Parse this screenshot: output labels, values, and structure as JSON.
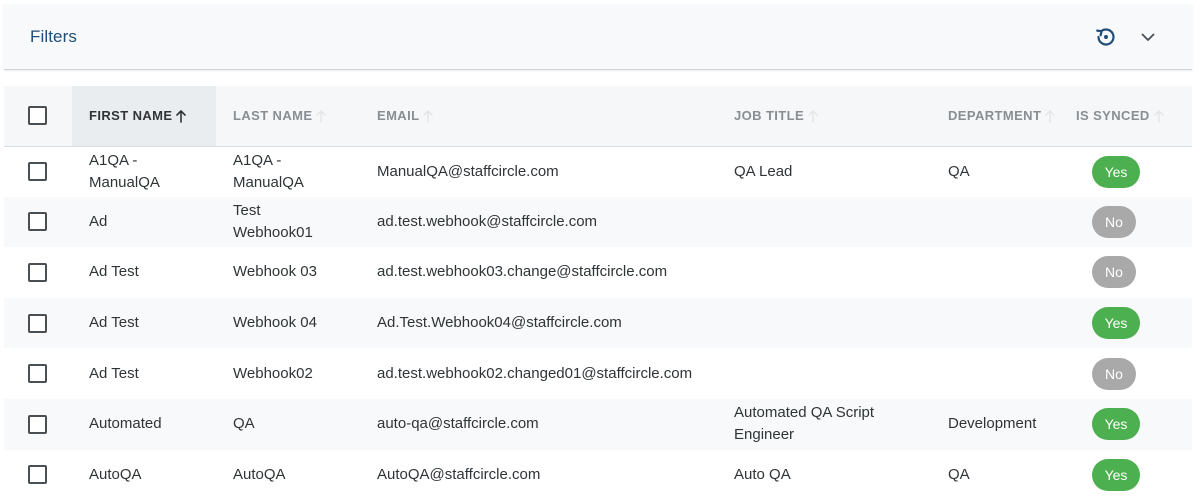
{
  "filters": {
    "title": "Filters",
    "reset_icon": "history-reset-icon",
    "expand_icon": "chevron-down-icon"
  },
  "table": {
    "columns": [
      {
        "label": "FIRST NAME",
        "sorted": "asc"
      },
      {
        "label": "LAST NAME"
      },
      {
        "label": "EMAIL"
      },
      {
        "label": "JOB TITLE"
      },
      {
        "label": "DEPARTMENT"
      },
      {
        "label": "IS SYNCED"
      }
    ],
    "rows": [
      {
        "first": "A1QA -\nManualQA",
        "last": "A1QA -\nManualQA",
        "email": "ManualQA@staffcircle.com",
        "job": "QA Lead",
        "dept": "QA",
        "synced": "Yes"
      },
      {
        "first": "Ad",
        "last": "Test\nWebhook01",
        "email": "ad.test.webhook@staffcircle.com",
        "job": "",
        "dept": "",
        "synced": "No"
      },
      {
        "first": "Ad Test",
        "last": "Webhook 03",
        "email": "ad.test.webhook03.change@staffcircle.com",
        "job": "",
        "dept": "",
        "synced": "No"
      },
      {
        "first": "Ad Test",
        "last": "Webhook 04",
        "email": "Ad.Test.Webhook04@staffcircle.com",
        "job": "",
        "dept": "",
        "synced": "Yes"
      },
      {
        "first": "Ad Test",
        "last": "Webhook02",
        "email": "ad.test.webhook02.changed01@staffcircle.com",
        "job": "",
        "dept": "",
        "synced": "No"
      },
      {
        "first": "Automated",
        "last": "QA",
        "email": "auto-qa@staffcircle.com",
        "job": "Automated QA Script\nEngineer",
        "dept": "Development",
        "synced": "Yes"
      },
      {
        "first": "AutoQA",
        "last": "AutoQA",
        "email": "AutoQA@staffcircle.com",
        "job": "Auto QA",
        "dept": "QA",
        "synced": "Yes"
      }
    ]
  },
  "colors": {
    "yes": "#4caf50",
    "no": "#a9a9a9",
    "title": "#1f4e79"
  }
}
